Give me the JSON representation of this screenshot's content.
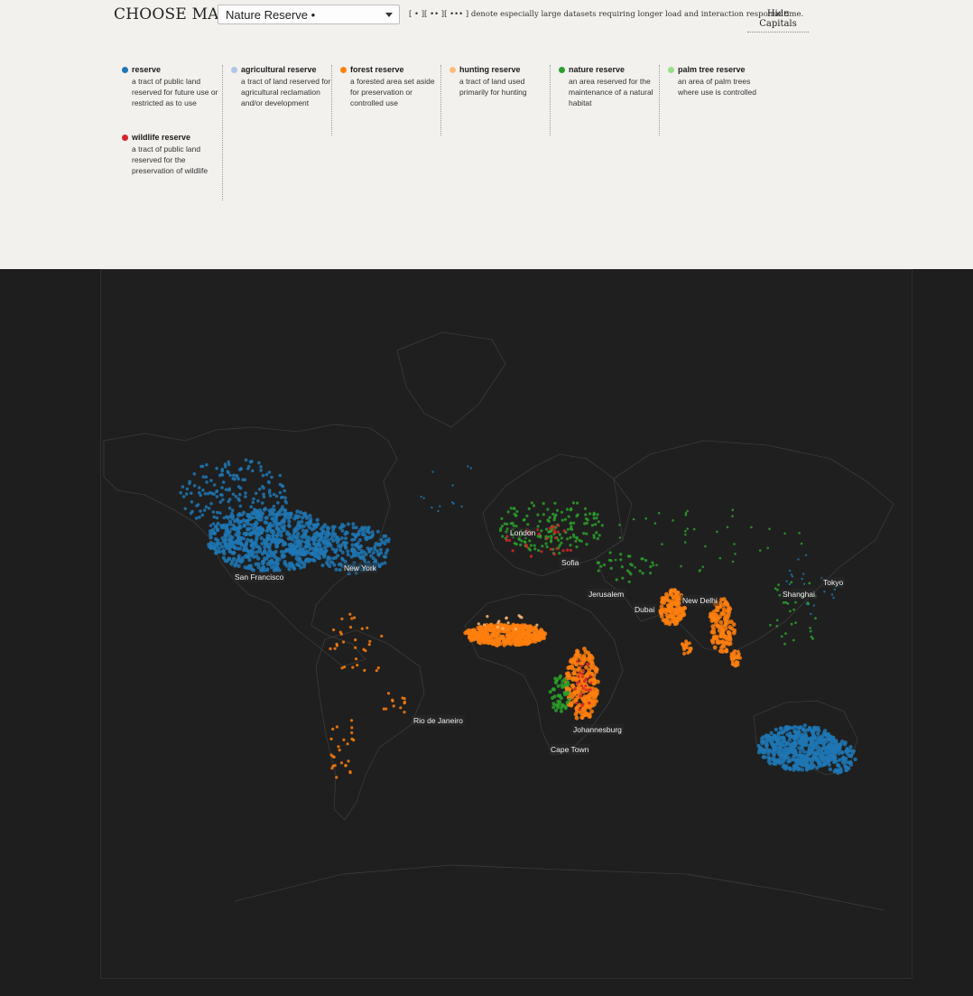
{
  "header": {
    "choose_label": "CHOOSE MAP:",
    "selected_map": "Nature Reserve •",
    "note": "[ • ][ •• ][ ••• ] denote especially large datasets requiring longer load and interaction response time.",
    "hide_capitals": "Hide Capitals"
  },
  "legend": [
    {
      "title": "reserve",
      "desc": "a tract of public land reserved for future use or restricted as to use",
      "color": "#1f77b4"
    },
    {
      "title": "agricultural reserve",
      "desc": "a tract of land reserved for agricultural reclamation and/or development",
      "color": "#aec7e8"
    },
    {
      "title": "forest reserve",
      "desc": "a forested area set aside for preservation or controlled use",
      "color": "#ff7f0e"
    },
    {
      "title": "hunting reserve",
      "desc": "a tract of land used primarily for hunting",
      "color": "#ffbb78"
    },
    {
      "title": "nature reserve",
      "desc": "an area reserved for the maintenance of a natural habitat",
      "color": "#2ca02c"
    },
    {
      "title": "palm tree reserve",
      "desc": "an area of palm trees where use is controlled",
      "color": "#98df8a"
    },
    {
      "title": "wildlife reserve",
      "desc": "a tract of public land reserved for the preservation of wildlife",
      "color": "#d62728"
    }
  ],
  "cities": [
    {
      "name": "San Francisco"
    },
    {
      "name": "New York"
    },
    {
      "name": "London"
    },
    {
      "name": "Sofia"
    },
    {
      "name": "Jerusalem"
    },
    {
      "name": "Dubai"
    },
    {
      "name": "New Delhi"
    },
    {
      "name": "Shanghai"
    },
    {
      "name": "Tokyo"
    },
    {
      "name": "Rio de Janeiro"
    },
    {
      "name": "Johannesburg"
    },
    {
      "name": "Cape Town"
    }
  ]
}
